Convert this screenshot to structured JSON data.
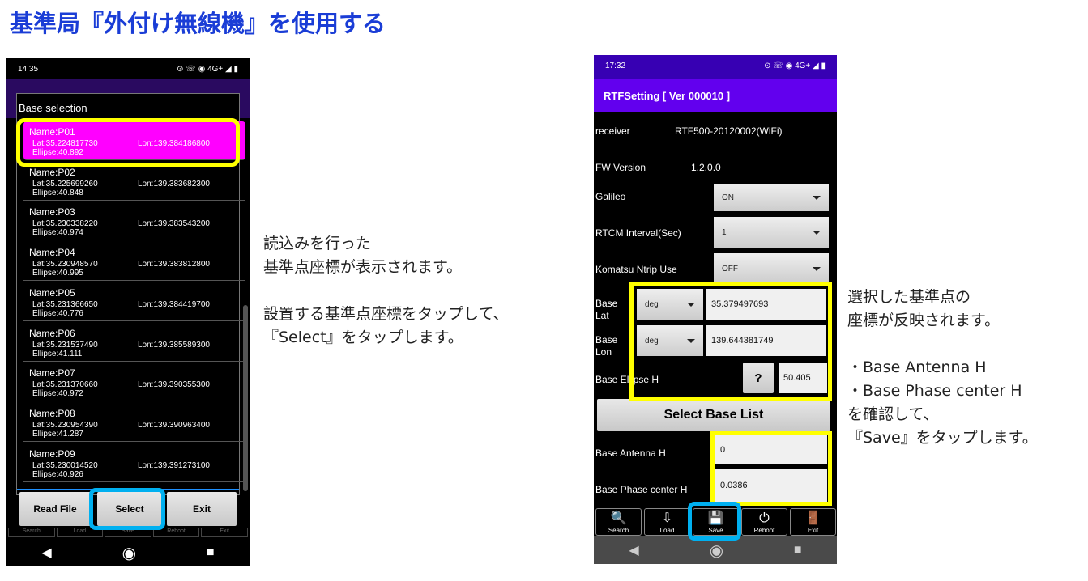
{
  "title": "基準局『外付け無線機』を使用する",
  "left_phone": {
    "status_time": "14:35",
    "status_icons": "⊙ ☏ ◉ 4G+ ◢ ▮",
    "dialog_title": "Base selection",
    "items": [
      {
        "name": "Name:P01",
        "lat": "Lat:35.224817730",
        "lon": "Lon:139.384186800",
        "ellipse": "Ellipse:40.892"
      },
      {
        "name": "Name:P02",
        "lat": "Lat:35.225699260",
        "lon": "Lon:139.383682300",
        "ellipse": "Ellipse:40.848"
      },
      {
        "name": "Name:P03",
        "lat": "Lat:35.230338220",
        "lon": "Lon:139.383543200",
        "ellipse": "Ellipse:40.974"
      },
      {
        "name": "Name:P04",
        "lat": "Lat:35.230948570",
        "lon": "Lon:139.383812800",
        "ellipse": "Ellipse:40.995"
      },
      {
        "name": "Name:P05",
        "lat": "Lat:35.231366650",
        "lon": "Lon:139.384419700",
        "ellipse": "Ellipse:40.776"
      },
      {
        "name": "Name:P06",
        "lat": "Lat:35.231537490",
        "lon": "Lon:139.385589300",
        "ellipse": "Ellipse:41.111"
      },
      {
        "name": "Name:P07",
        "lat": "Lat:35.231370660",
        "lon": "Lon:139.390355300",
        "ellipse": "Ellipse:40.972"
      },
      {
        "name": "Name:P08",
        "lat": "Lat:35.230954390",
        "lon": "Lon:139.390963400",
        "ellipse": "Ellipse:41.287"
      },
      {
        "name": "Name:P09",
        "lat": "Lat:35.230014520",
        "lon": "Lon:139.391273100",
        "ellipse": "Ellipse:40.926"
      }
    ],
    "buttons": {
      "read_file": "Read File",
      "select": "Select",
      "exit": "Exit"
    },
    "toolbar": [
      "Search",
      "Load",
      "Save",
      "Reboot",
      "Exit"
    ]
  },
  "right_phone": {
    "status_time": "17:32",
    "status_icons": "⊙ ☏ ◉ 4G+ ◢ ▮",
    "app_title": "RTFSetting  [ Ver 000010 ]",
    "receiver_label": "receiver",
    "receiver_value": "RTF500-20120002(WiFi)",
    "fw_label": "FW Version",
    "fw_value": "1.2.0.0",
    "galileo_label": "Galileo",
    "galileo_value": "ON",
    "rtcm_label": "RTCM Interval(Sec)",
    "rtcm_value": "1",
    "ntrip_label": "Komatsu Ntrip Use",
    "ntrip_value": "OFF",
    "base_lat_label": "Base\nLat",
    "base_lat_unit": "deg",
    "base_lat_value": "35.379497693",
    "base_lon_label": "Base\nLon",
    "base_lon_unit": "deg",
    "base_lon_value": "139.644381749",
    "ellipse_label": "Base Ellipse H",
    "help": "?",
    "ellipse_value": "50.405",
    "select_base_list": "Select Base List",
    "antenna_label": "Base Antenna H",
    "antenna_value": "0",
    "phase_label": "Base Phase center H",
    "phase_value": "0.0386",
    "toolbar": [
      {
        "label": "Search",
        "icon": "search-icon"
      },
      {
        "label": "Load",
        "icon": "load-icon"
      },
      {
        "label": "Save",
        "icon": "save-icon"
      },
      {
        "label": "Reboot",
        "icon": "power-icon"
      },
      {
        "label": "Exit",
        "icon": "exit-icon"
      }
    ]
  },
  "notes": {
    "left": "読込みを行った\n基準点座標が表示されます。\n\n設置する基準点座標をタップして、\n『Select』をタップします。",
    "right": "選択した基準点の\n座標が反映されます。\n\n・Base Antenna H\n・Base Phase center H\nを確認して、\n『Save』をタップします。"
  },
  "colors": {
    "highlight_item": "#ff00ff",
    "callout_yellow": "#ffff00",
    "callout_blue": "#00b0f0",
    "app_bar": "#6200ee",
    "title": "#1a3dd6"
  }
}
